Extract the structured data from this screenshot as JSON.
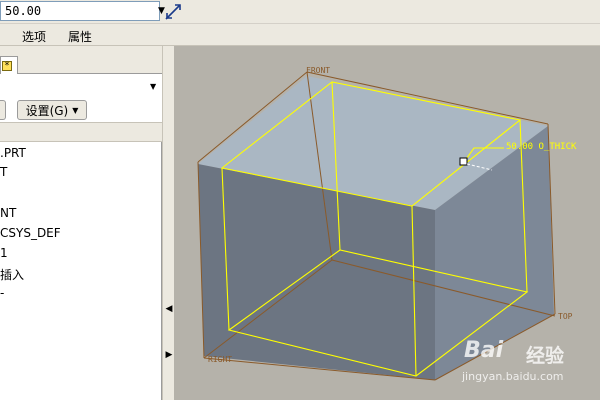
{
  "dashboard": {
    "thickness_value": "50.00",
    "dropdown_arrow": "▼"
  },
  "menu": {
    "options_label": "选项",
    "properties_label": "属性"
  },
  "left_panel": {
    "tab_glyph": "*",
    "dropdown_arrow": "▼",
    "settings_button_label": "设置(G)",
    "settings_arrow": "▼",
    "tree_items": [
      ".PRT",
      "T",
      "NT",
      "CSYS_DEF",
      "1",
      "插入",
      "-"
    ]
  },
  "splitter": {
    "collapse_arrow": "◀",
    "expand_arrow": "▶"
  },
  "graphics": {
    "datum_front": "FRONT",
    "datum_right": "RIGHT",
    "datum_top": "TOP",
    "dimension_label": "50.00 O_THICK",
    "colors": {
      "background": "#b5b2aa",
      "top_face": "#aab7c3",
      "right_face": "#7d8897",
      "front_face": "#6c7582",
      "edge_yellow": "#ffff00",
      "datum_brown": "#8a5a2a"
    }
  },
  "watermark": {
    "brand": "Bai",
    "brand_cn": "经验",
    "url": "jingyan.baidu.com"
  }
}
